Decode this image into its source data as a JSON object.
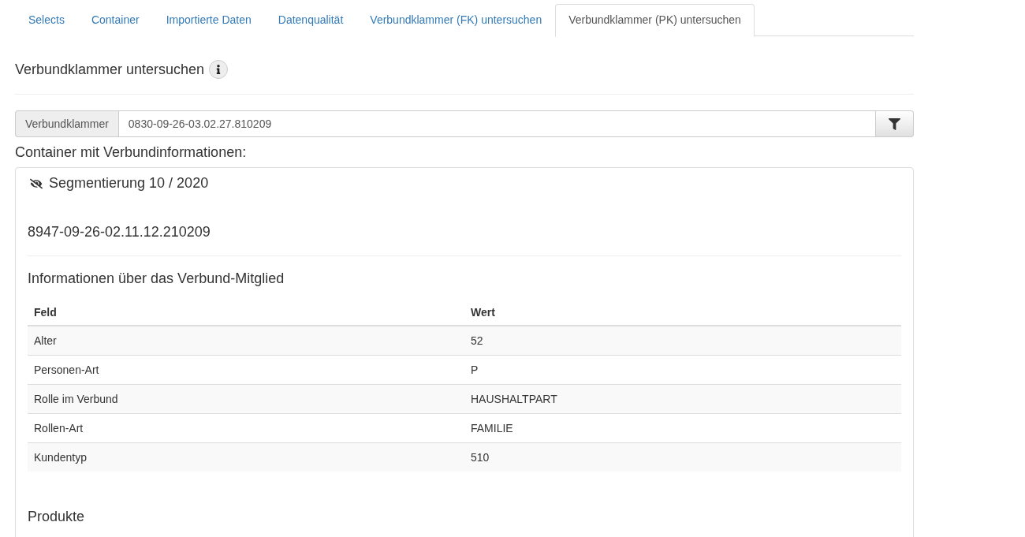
{
  "tabs": [
    {
      "label": "Selects",
      "selected": false
    },
    {
      "label": "Container",
      "selected": false
    },
    {
      "label": "Importierte Daten",
      "selected": false
    },
    {
      "label": "Datenqualität",
      "selected": false
    },
    {
      "label": "Verbundklammer (FK) untersuchen",
      "selected": false
    },
    {
      "label": "Verbundklammer (PK) untersuchen",
      "selected": true
    }
  ],
  "heading": "Verbundklammer untersuchen",
  "filter": {
    "addon": "Verbundklammer",
    "value": "0830-09-26-03.02.27.810209"
  },
  "section_label": "Container mit Verbundinformationen:",
  "panel": {
    "title": "Segmentierung 10 / 2020",
    "member_id": "8947-09-26-02.11.12.210209",
    "subheading": "Informationen über das Verbund-Mitglied",
    "table": {
      "columns": [
        "Feld",
        "Wert"
      ],
      "rows": [
        [
          "Alter",
          "52"
        ],
        [
          "Personen-Art",
          "P"
        ],
        [
          "Rolle im Verbund",
          "HAUSHALTPART"
        ],
        [
          "Rollen-Art",
          "FAMILIE"
        ],
        [
          "Kundentyp",
          "510"
        ]
      ]
    },
    "products_heading": "Produkte"
  }
}
